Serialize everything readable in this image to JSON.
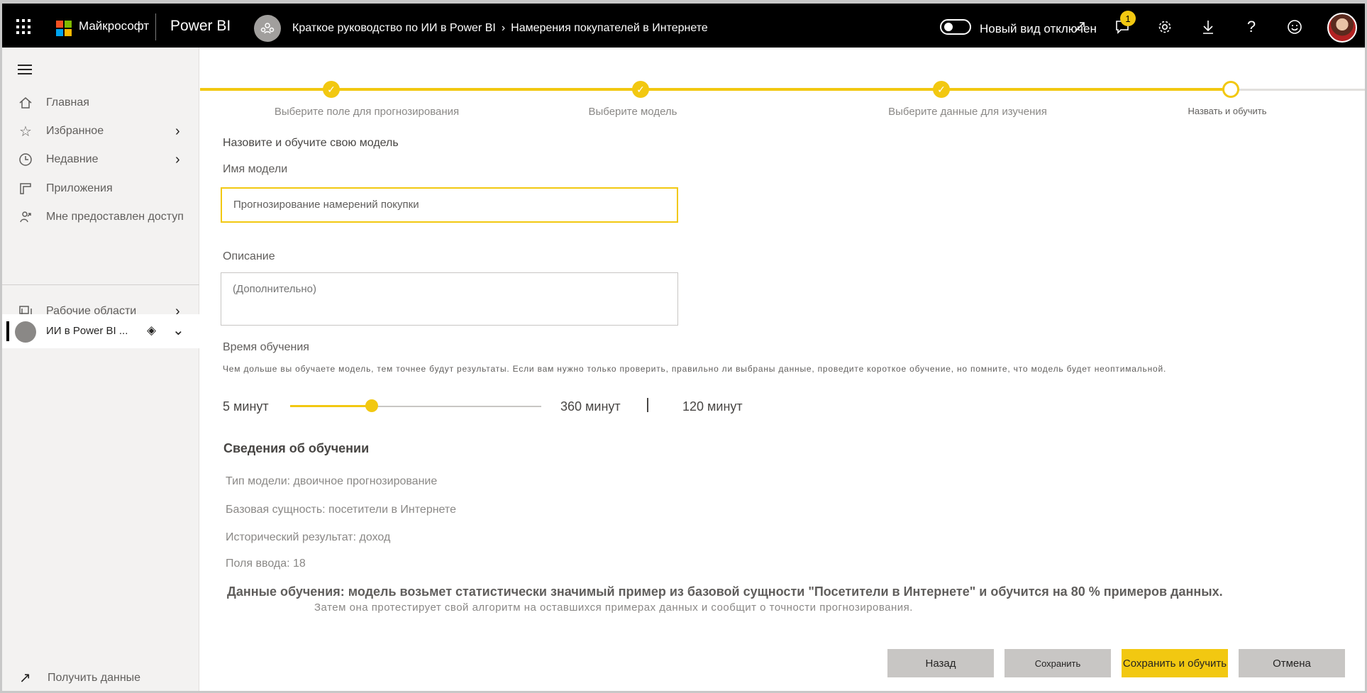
{
  "topbar": {
    "brand": "Майкрософт",
    "app_name": "Power BI",
    "breadcrumb_workspace": "Краткое руководство по ИИ в Power BI",
    "breadcrumb_sep": "›",
    "breadcrumb_page": "Намерения покупателей в Интернете",
    "toggle_label": "Новый вид отключен",
    "notification_count": "1",
    "icons": [
      "waffle-icon",
      "expand-icon",
      "notifications-icon",
      "settings-icon",
      "download-icon",
      "help-icon",
      "feedback-icon"
    ]
  },
  "sidebar": {
    "items": [
      {
        "label": "Главная",
        "icon": "home-icon"
      },
      {
        "label": "Избранное",
        "icon": "star-icon"
      },
      {
        "label": "Недавние",
        "icon": "clock-icon"
      },
      {
        "label": "Приложения",
        "icon": "apps-icon"
      },
      {
        "label": "Мне предоставлен доступ",
        "icon": "shared-icon"
      },
      {
        "label": "Рабочие области",
        "icon": "workspaces-icon"
      }
    ],
    "current_workspace": "ИИ в Power BI ...",
    "get_data": "Получить данные"
  },
  "stepper": {
    "steps": [
      {
        "label": "Выберите поле для прогнозирования",
        "done": true
      },
      {
        "label": "Выберите модель",
        "done": true
      },
      {
        "label": "Выберите данные для изучения",
        "done": true
      },
      {
        "label": "Назвать и обучить",
        "done": false
      }
    ],
    "check": "✓"
  },
  "form": {
    "section_title": "Назовите и обучите свою модель",
    "name_label": "Имя модели",
    "name_value": "Прогнозирование намерений покупки",
    "desc_label": "Описание",
    "desc_placeholder": "(Дополнительно)",
    "training_label": "Время обучения",
    "training_help": "Чем дольше вы обучаете модель, тем точнее будут результаты. Если вам нужно только проверить, правильно ли выбраны данные, проведите короткое обучение, но помните, что модель будет неоптимальной.",
    "slider_min": "5 минут",
    "slider_max": "360 минут",
    "slider_value": "120 минут",
    "slider_min_minutes": 5,
    "slider_max_minutes": 360,
    "slider_value_minutes": 120
  },
  "info": {
    "title": "Сведения об обучении",
    "model_type": "Тип модели: двоичное прогнозирование",
    "base_entity": "Базовая сущность: посетители в Интернете",
    "historic_result": "Исторический результат: доход",
    "input_fields": "Поля ввода: 18",
    "summary_bold": "Данные обучения: модель возьмет статистически значимый пример из базовой сущности \"Посетители в Интернете\" и обучится на 80 % примеров данных.",
    "summary_sub": "Затем она протестирует свой алгоритм на оставшихся примерах данных и сообщит о точности прогнозирования."
  },
  "buttons": {
    "back": "Назад",
    "save": "Сохранить",
    "save_train": "Сохранить и обучить",
    "cancel": "Отмена"
  },
  "colors": {
    "accent": "#f2c811",
    "topbar": "#000000",
    "sidebar": "#f3f2f1",
    "button_secondary": "#c8c6c4"
  }
}
